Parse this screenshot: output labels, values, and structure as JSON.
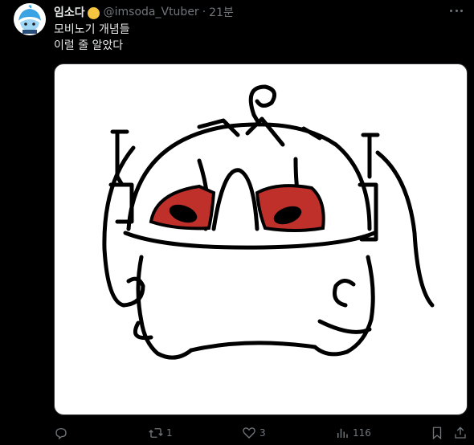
{
  "post": {
    "author_name": "임소다",
    "handle": "@imsoda_Vtuber",
    "separator": "·",
    "time": "21분",
    "text_line1": "모비노기 개념들",
    "text_line2": "이럴 줄 알았다"
  },
  "actions": {
    "reply_count": "",
    "repost_count": "1",
    "like_count": "3",
    "views_count": "116"
  },
  "colors": {
    "background": "#000000",
    "text": "#e7e9ea",
    "muted": "#71767b",
    "eye_red": "#c0302b",
    "badge": "#f5c542"
  },
  "icons": [
    "more-icon",
    "reply-icon",
    "repost-icon",
    "like-icon",
    "views-icon",
    "bookmark-icon",
    "share-icon",
    "verified-badge-icon"
  ]
}
